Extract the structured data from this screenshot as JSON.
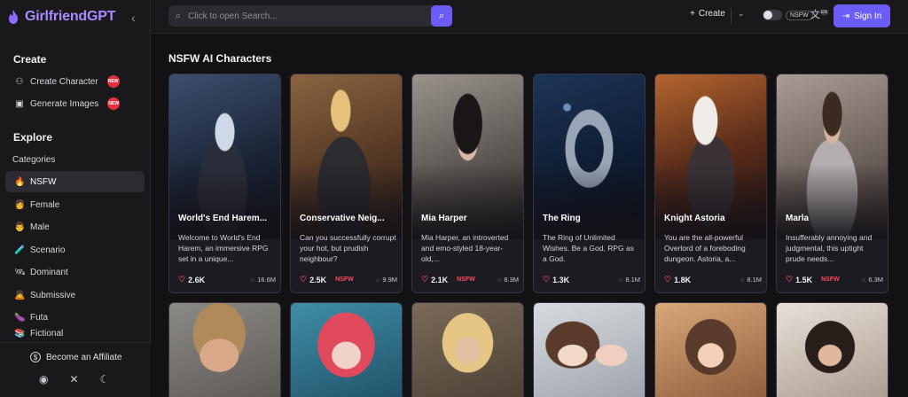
{
  "app": {
    "name": "GirlfriendGPT",
    "colors": {
      "accent": "#6b5cf6",
      "logo": "#a98bff",
      "nsfw_tag": "#ff4a5c",
      "new_badge": "#e5303e"
    }
  },
  "sidebar": {
    "create_title": "Create",
    "create_items": [
      {
        "label": "Create Character",
        "icon": "user-plus-icon",
        "badge": "NEW"
      },
      {
        "label": "Generate Images",
        "icon": "image-icon",
        "badge": "NEW"
      }
    ],
    "explore_title": "Explore",
    "categories_label": "Categories",
    "categories": [
      {
        "label": "NSFW",
        "emoji": "🔥",
        "active": true
      },
      {
        "label": "Female",
        "emoji": "👩"
      },
      {
        "label": "Male",
        "emoji": "👨"
      },
      {
        "label": "Scenario",
        "emoji": "🧪"
      },
      {
        "label": "Dominant",
        "emoji": "🛰"
      },
      {
        "label": "Submissive",
        "emoji": "🙇"
      },
      {
        "label": "Futa",
        "emoji": "🍆"
      },
      {
        "label": "Fictional",
        "emoji": "📚"
      }
    ],
    "affiliate_label": "Become an Affiliate"
  },
  "topbar": {
    "search_placeholder": "Click to open Search...",
    "create_label": "Create",
    "nsfw_label": "NSFW",
    "lang_badge": "EN",
    "signin_label": "Sign In"
  },
  "main": {
    "title": "NSFW AI Characters",
    "cards": [
      {
        "name": "World's End Harem...",
        "desc": "Welcome to World's End Harem, an immersive RPG set in a unique...",
        "likes": "2.6K",
        "tag": "",
        "views": "16.6M"
      },
      {
        "name": "Conservative Neig...",
        "desc": "Can you successfully corrupt your hot, but prudish neighbour?",
        "likes": "2.5K",
        "tag": "NSFW",
        "views": "9.9M"
      },
      {
        "name": "Mia Harper",
        "desc": "Mia Harper, an introverted and emo-styled 18-year-old,...",
        "likes": "2.1K",
        "tag": "NSFW",
        "views": "8.3M"
      },
      {
        "name": "The Ring",
        "desc": "The Ring of Unlimited Wishes. Be a God, RPG as a God.",
        "likes": "1.3K",
        "tag": "",
        "views": "8.1M"
      },
      {
        "name": "Knight Astoria",
        "desc": "You are the all-powerful Overlord of a foreboding dungeon. Astoria, a...",
        "likes": "1.8K",
        "tag": "",
        "views": "8.1M"
      },
      {
        "name": "Marla",
        "desc": "Insufferably annoying and judgmental, this uptight prude needs...",
        "likes": "1.5K",
        "tag": "NSFW",
        "views": "6.3M"
      }
    ]
  }
}
